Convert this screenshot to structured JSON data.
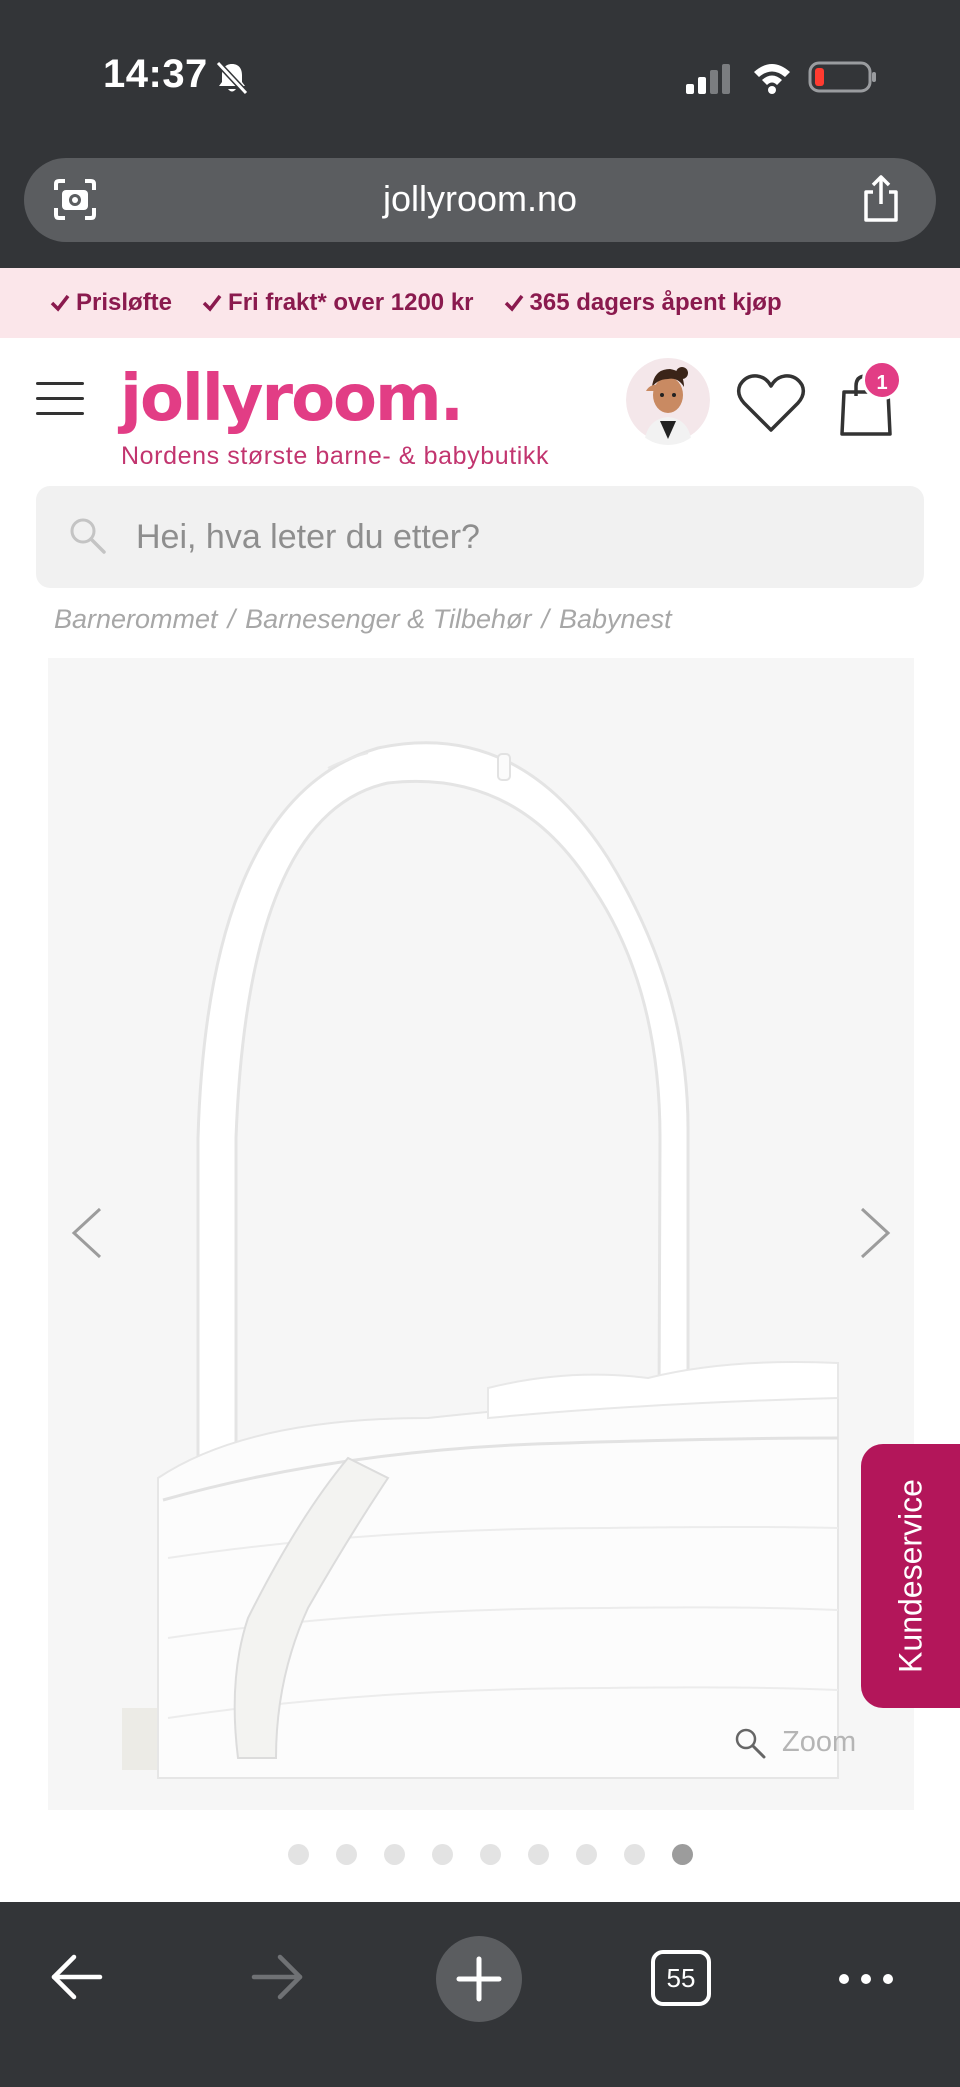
{
  "status_bar": {
    "time": "14:37"
  },
  "browser": {
    "url": "jollyroom.no",
    "tabs_count": "55"
  },
  "usp": [
    {
      "label": "Prisløfte"
    },
    {
      "label": "Fri frakt* over 1200 kr"
    },
    {
      "label": "365 dagers åpent kjøp"
    }
  ],
  "header": {
    "logo": "jollyroom.",
    "tagline": "Nordens største barne- & babybutikk",
    "cart_count": "1"
  },
  "search": {
    "placeholder": "Hei, hva leter du etter?"
  },
  "breadcrumb": {
    "items": [
      "Barnerommet",
      "Barnesenger & Tilbehør",
      "Babynest"
    ],
    "separator": "/"
  },
  "gallery": {
    "zoom_label": "Zoom",
    "image_count": 9,
    "active_index": 8
  },
  "kundeservice": {
    "label": "Kundeservice"
  },
  "colors": {
    "brand_pink": "#e23d85",
    "brand_dark": "#8a1a4e",
    "kundeservice_bg": "#b3165a",
    "browser_chrome": "#333538"
  }
}
